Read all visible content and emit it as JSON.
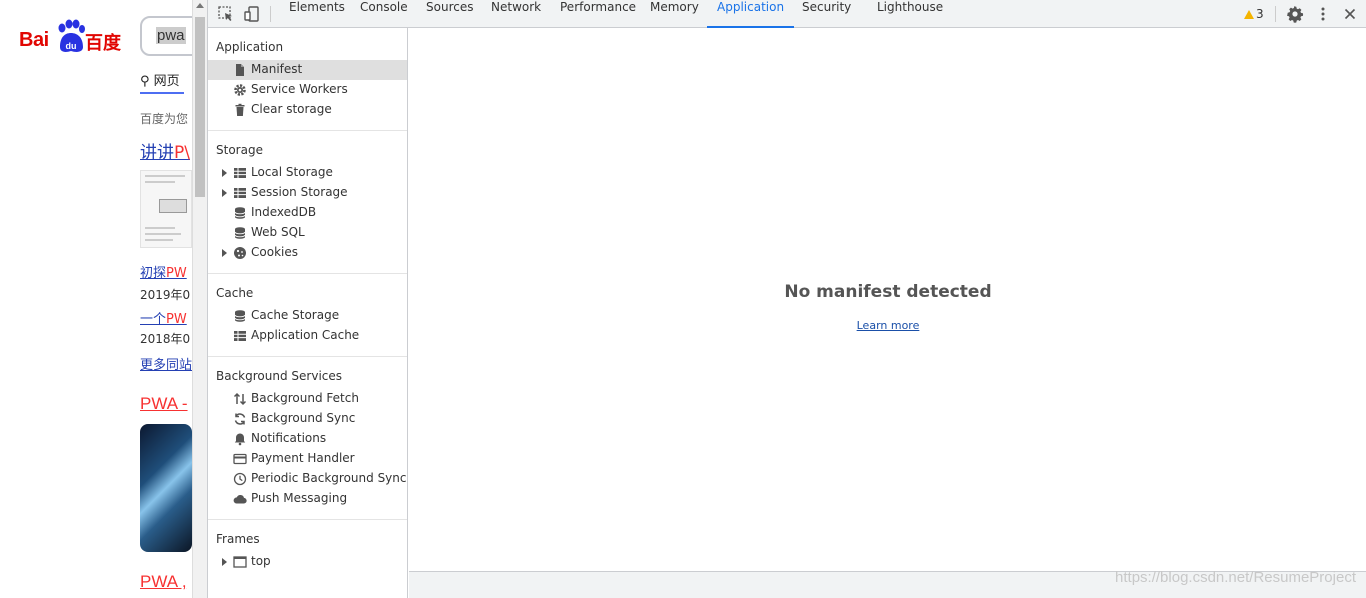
{
  "baidu": {
    "logo_left": "Bai",
    "logo_right": "百度",
    "search_value": "pwa",
    "tab_web": "网页",
    "intro": "百度为您",
    "result1_title_a": "讲讲",
    "result1_title_b": "P\\",
    "sub1_a": "初探",
    "sub1_b": "PW",
    "date1": "2019年0",
    "sub2_a": "一个",
    "sub2_b": "PW",
    "date2": "2018年0",
    "more": "更多同站",
    "result2_title": "PWA -",
    "result3_title": "PWA ,"
  },
  "devtools": {
    "tabs": [
      "Elements",
      "Console",
      "Sources",
      "Network",
      "Performance",
      "Memory",
      "Application",
      "Security",
      "Lighthouse"
    ],
    "active_tab": "Application",
    "warning_count": "3",
    "sidebar": {
      "application": {
        "title": "Application",
        "items": [
          "Manifest",
          "Service Workers",
          "Clear storage"
        ]
      },
      "storage": {
        "title": "Storage",
        "items": [
          "Local Storage",
          "Session Storage",
          "IndexedDB",
          "Web SQL",
          "Cookies"
        ]
      },
      "cache": {
        "title": "Cache",
        "items": [
          "Cache Storage",
          "Application Cache"
        ]
      },
      "background": {
        "title": "Background Services",
        "items": [
          "Background Fetch",
          "Background Sync",
          "Notifications",
          "Payment Handler",
          "Periodic Background Sync",
          "Push Messaging"
        ]
      },
      "frames": {
        "title": "Frames",
        "items": [
          "top"
        ]
      }
    },
    "main": {
      "heading": "No manifest detected",
      "link": "Learn more"
    }
  },
  "watermark": "https://blog.csdn.net/ResumeProject"
}
